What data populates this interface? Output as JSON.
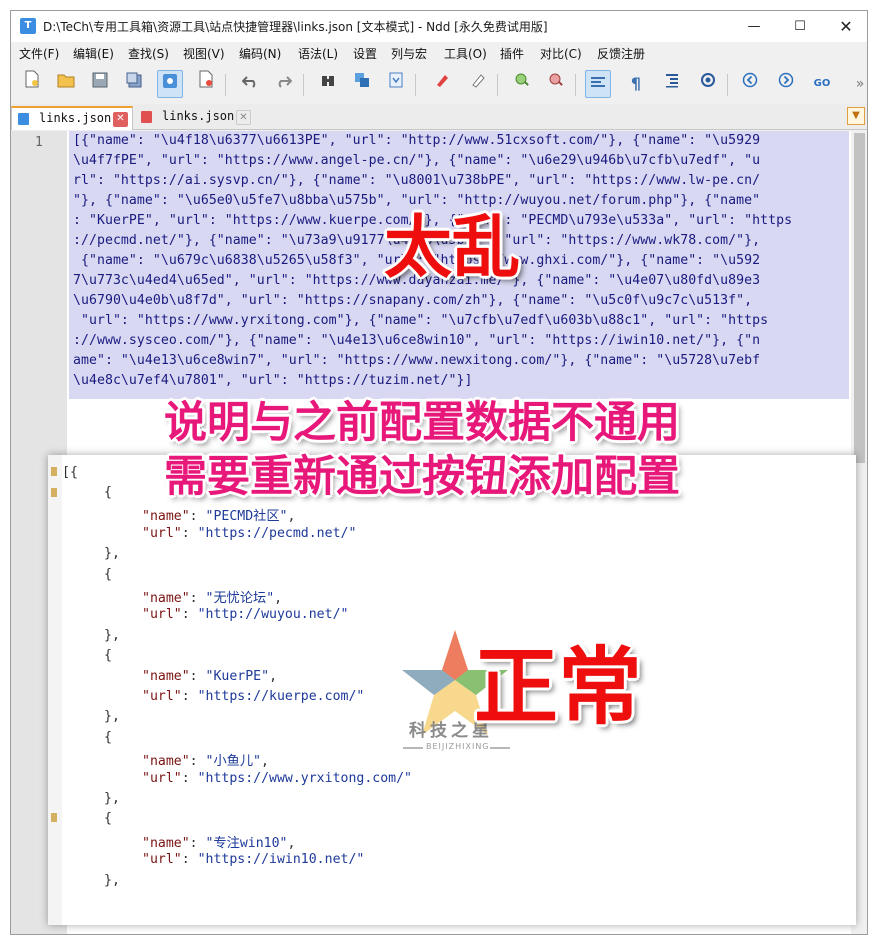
{
  "window": {
    "title": "D:\\TeCh\\专用工具箱\\资源工具\\站点快捷管理器\\links.json [文本模式] - Ndd [永久免费试用版]",
    "app_icon": "T",
    "minimize": "—",
    "maximize": "☐",
    "close": "✕"
  },
  "menu": [
    "文件(F)",
    "编辑(E)",
    "查找(S)",
    "视图(V)",
    "编码(N)",
    "语法(L)",
    "设置",
    "列与宏",
    "工具(O)",
    "插件",
    "对比(C)",
    "反馈注册"
  ],
  "toolbar": {
    "icons": [
      "new-file-icon",
      "open-folder-icon",
      "save-icon",
      "save-all-icon",
      "close-file-icon",
      "close-all-icon",
      "undo-icon",
      "redo-icon",
      "find-icon",
      "replace-icon",
      "bookmark-icon",
      "highlight-icon",
      "eraser-icon",
      "zoom-in-icon",
      "zoom-out-icon",
      "word-wrap-icon",
      "show-symbols-icon",
      "indent-guide-icon",
      "record-icon",
      "prev-icon",
      "next-icon",
      "goto-icon",
      "overflow-icon"
    ],
    "goto_label": "GO",
    "overflow_label": "»"
  },
  "tabs": [
    {
      "label": "links.json",
      "active": true
    },
    {
      "label": "links.json",
      "active": false
    }
  ],
  "editor": {
    "line_number": "1",
    "raw_lines": [
      "[{\"name\": \"\\u4f18\\u6377\\u6613PE\", \"url\": \"http://www.51cxsoft.com/\"}, {\"name\": \"\\u5929",
      "\\u4f7fPE\", \"url\": \"https://www.angel-pe.cn/\"}, {\"name\": \"\\u6e29\\u946b\\u7cfb\\u7edf\", \"u",
      "rl\": \"https://ai.sysvp.cn/\"}, {\"name\": \"\\u8001\\u738bPE\", \"url\": \"https://www.lw-pe.cn/",
      "\"}, {\"name\": \"\\u65e0\\u5fe7\\u8bba\\u575b\", \"url\": \"http://wuyou.net/forum.php\"}, {\"name\"",
      ": \"KuerPE\", \"url\": \"https://www.kuerpe.com/\"}, {\"name\": \"PECMD\\u793e\\u533a\", \"url\": \"https",
      "://pecmd.net/\"}, {\"name\": \"\\u73a9\\u9177\\u4e4b\\u5bb6\", \"url\": \"https://www.wk78.com/\"},",
      " {\"name\": \"\\u679c\\u6838\\u5265\\u58f3\", \"url\": \"https://www.ghxi.com/\"}, {\"name\": \"\\u592",
      "7\\u773c\\u4ed4\\u65ed\", \"url\": \"https://www.dayanzai.me/\"}, {\"name\": \"\\u4e07\\u80fd\\u89e3",
      "\\u6790\\u4e0b\\u8f7d\", \"url\": \"https://snapany.com/zh\"}, {\"name\": \"\\u5c0f\\u9c7c\\u513f\",",
      " \"url\": \"https://www.yrxitong.com\"}, {\"name\": \"\\u7cfb\\u7edf\\u603b\\u88c1\", \"url\": \"https",
      "://www.sysceo.com/\"}, {\"name\": \"\\u4e13\\u6ce8win10\", \"url\": \"https://iwin10.net/\"}, {\"n",
      "ame\": \"\\u4e13\\u6ce8win7\", \"url\": \"https://www.newxitong.com/\"}, {\"name\": \"\\u5728\\u7ebf",
      "\\u4e8c\\u7ef4\\u7801\", \"url\": \"https://tuzim.net/\"}]"
    ]
  },
  "formatted": {
    "open": "[{",
    "entries": [
      {
        "name": "PECMD社区",
        "url": "https://pecmd.net/"
      },
      {
        "name": "无忧论坛",
        "url": "http://wuyou.net/"
      },
      {
        "name": "KuerPE",
        "url": "https://kuerpe.com/"
      },
      {
        "name": "小鱼儿",
        "url": "https://www.yrxitong.com/"
      },
      {
        "name": "专注win10",
        "url": "https://iwin10.net/"
      }
    ],
    "brace_open": "{",
    "brace_close": "},",
    "key_name": "\"name\"",
    "key_url": "\"url\"",
    "colon": ": ",
    "comma": ","
  },
  "annotations": {
    "chaos": "太乱",
    "note_line1": "说明与之前配置数据不通用",
    "note_line2": "需要重新通过按钮添加配置",
    "normal": "正常"
  },
  "watermark": {
    "text": "科技之星",
    "sub": "BEIJIZHIXING"
  },
  "colors": {
    "accent_tab": "#f0a030",
    "selection_bg": "#d8d8f2",
    "annotation_red": "#ee0e0e",
    "annotation_pink": "#e8187a",
    "json_key": "#7a1414",
    "json_string": "#1e3a9a"
  }
}
